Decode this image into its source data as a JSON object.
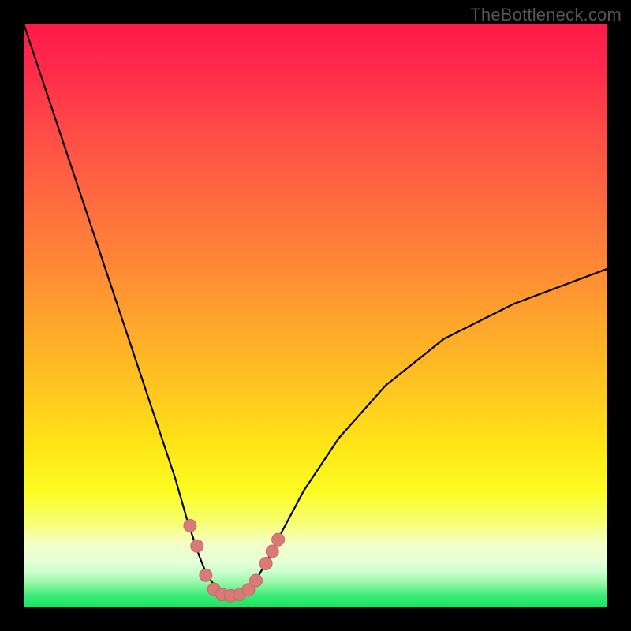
{
  "watermark": "TheBottleneck.com",
  "colors": {
    "frame_bg": "#000000",
    "curve_stroke": "#000000",
    "marker_fill": "#d87a78",
    "marker_stroke": "#c76967"
  },
  "chart_data": {
    "type": "line",
    "title": "",
    "xlabel": "",
    "ylabel": "",
    "xlim": [
      0,
      100
    ],
    "ylim": [
      0,
      100
    ],
    "note": "Axes carry no tick labels in the image; values below are estimated from pixel positions on a 0–100 normalized grid where y=0 is the bottom (green) edge and x=0 is the left edge.",
    "series": [
      {
        "name": "curve",
        "x": [
          0,
          4,
          8,
          12,
          16,
          20,
          24,
          26,
          28,
          30,
          31,
          32,
          33,
          34,
          35,
          36,
          37,
          38,
          39,
          40,
          42,
          44,
          48,
          54,
          62,
          72,
          84,
          100
        ],
        "y": [
          100,
          88,
          76,
          64,
          52,
          40,
          28,
          22,
          15,
          9,
          6.5,
          4.7,
          3.4,
          2.5,
          2.1,
          2.0,
          2.1,
          2.6,
          3.6,
          5.0,
          8.5,
          12.5,
          20,
          29,
          38,
          46,
          52,
          58
        ]
      }
    ],
    "markers": {
      "name": "highlighted-points",
      "shape": "circle",
      "radius_px": 8,
      "points_xy": [
        [
          28.5,
          14
        ],
        [
          29.7,
          10.5
        ],
        [
          31.2,
          5.5
        ],
        [
          32.6,
          3.1
        ],
        [
          34.0,
          2.2
        ],
        [
          35.5,
          2.0
        ],
        [
          37.0,
          2.2
        ],
        [
          38.5,
          3.0
        ],
        [
          39.8,
          4.6
        ],
        [
          41.5,
          7.5
        ],
        [
          42.6,
          9.6
        ],
        [
          43.6,
          11.6
        ]
      ]
    }
  }
}
